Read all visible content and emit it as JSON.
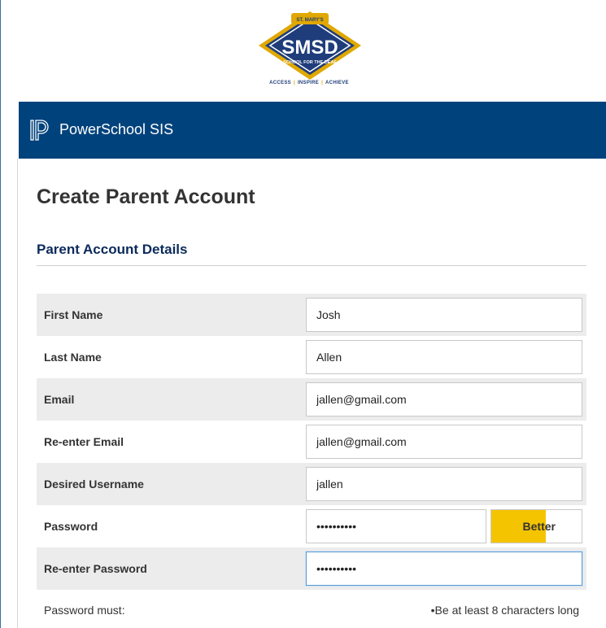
{
  "branding": {
    "logo_top_text": "ST. MARY'S",
    "logo_main_text": "SMSD",
    "logo_sub_text": "SCHOOL FOR THE DEAF",
    "tagline": [
      "ACCESS",
      "INSPIRE",
      "ACHIEVE"
    ],
    "colors": {
      "navy": "#1f3d7a",
      "gold": "#e0a800"
    }
  },
  "header": {
    "app_title": "PowerSchool SIS",
    "logo_icon": "powerschool-logo-icon",
    "color": "#00427c"
  },
  "page": {
    "title": "Create Parent Account",
    "section_title": "Parent Account Details"
  },
  "form": {
    "rows": [
      {
        "label": "First Name",
        "value": "Josh"
      },
      {
        "label": "Last Name",
        "value": "Allen"
      },
      {
        "label": "Email",
        "value": "jallen@gmail.com"
      },
      {
        "label": "Re-enter Email",
        "value": "jallen@gmail.com"
      },
      {
        "label": "Desired Username",
        "value": "jallen"
      },
      {
        "label": "Password",
        "value": "••••••••••"
      },
      {
        "label": "Re-enter Password",
        "value": "••••••••••"
      }
    ],
    "strength": {
      "label": "Better",
      "level": 0.6,
      "color": "#f5c400"
    }
  },
  "password_rules": {
    "label": "Password must:",
    "items": [
      "•Be at least 8 characters long"
    ]
  }
}
